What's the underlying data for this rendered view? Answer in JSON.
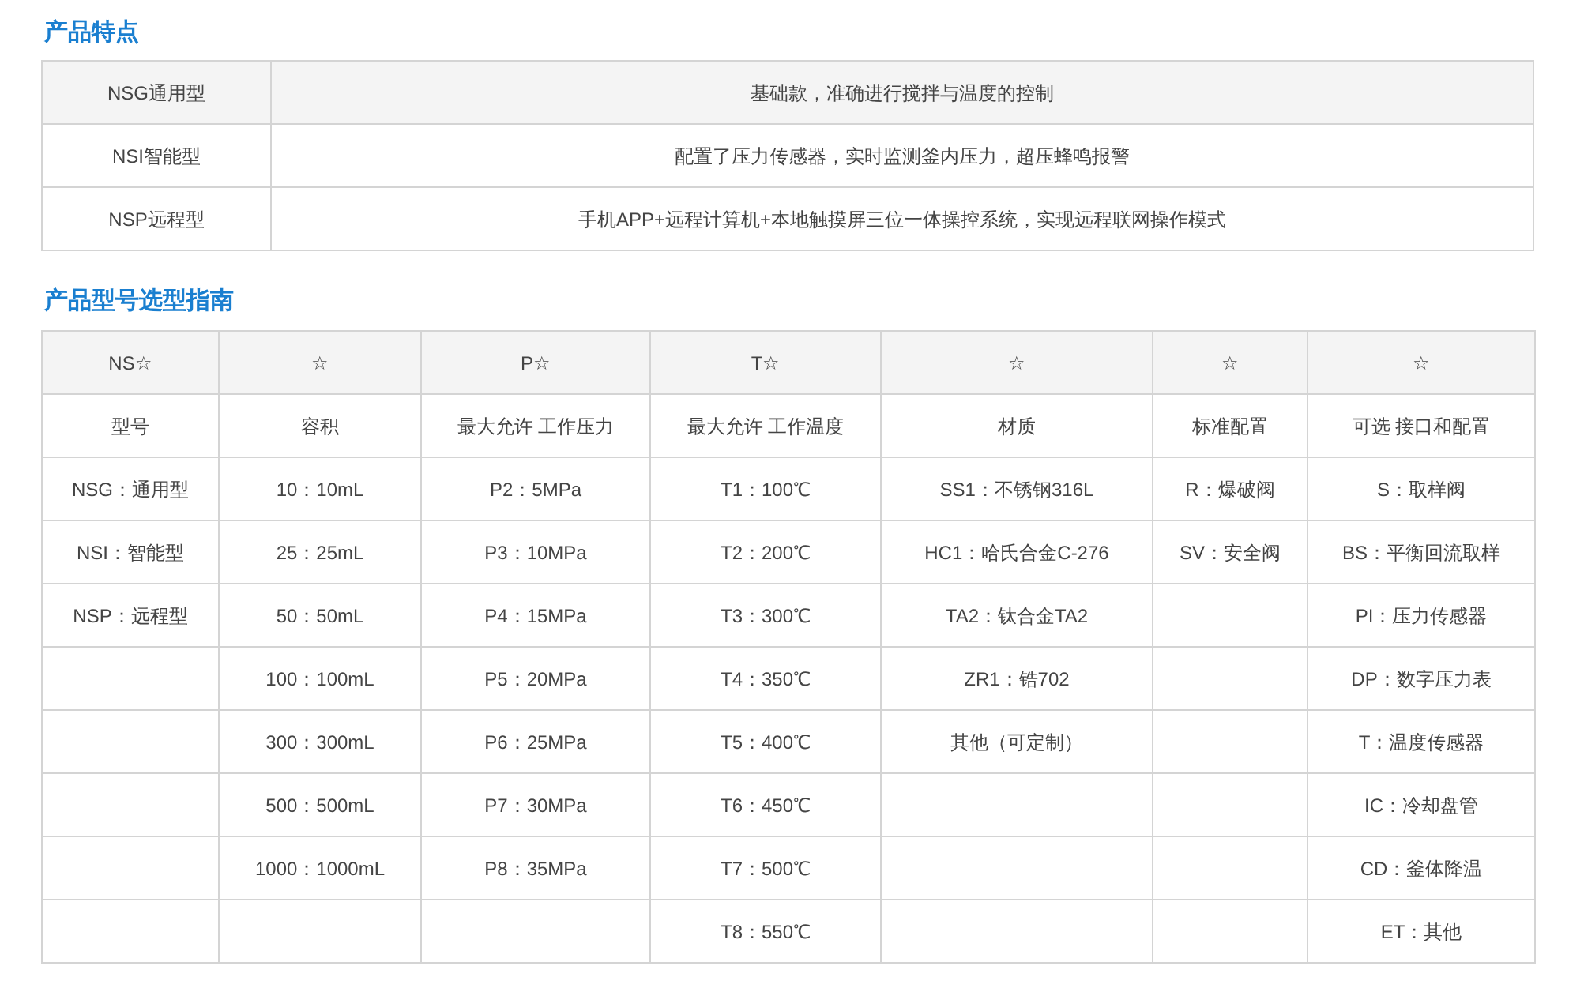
{
  "features": {
    "title": "产品特点",
    "rows": [
      {
        "model": "NSG通用型",
        "description": "基础款，准确进行搅拌与温度的控制"
      },
      {
        "model": "NSI智能型",
        "description": "配置了压力传感器，实时监测釜内压力，超压蜂鸣报警"
      },
      {
        "model": "NSP远程型",
        "description": "手机APP+远程计算机+本地触摸屏三位一体操控系统，实现远程联网操作模式"
      }
    ]
  },
  "guide": {
    "title": "产品型号选型指南",
    "columns": [
      {
        "header": "NS☆",
        "label": "型号",
        "values": [
          "NSG：通用型",
          "NSI：智能型",
          "NSP：远程型"
        ]
      },
      {
        "header": "☆",
        "label": "容积",
        "values": [
          "10：10mL",
          "25：25mL",
          "50：50mL",
          "100：100mL",
          "300：300mL",
          "500：500mL",
          "1000：1000mL"
        ]
      },
      {
        "header": "P☆",
        "label": "最大允许 工作压力",
        "values": [
          "P2：5MPa",
          "P3：10MPa",
          "P4：15MPa",
          "P5：20MPa",
          "P6：25MPa",
          "P7：30MPa",
          "P8：35MPa"
        ]
      },
      {
        "header": "T☆",
        "label": "最大允许 工作温度",
        "values": [
          "T1：100℃",
          "T2：200℃",
          "T3：300℃",
          "T4：350℃",
          "T5：400℃",
          "T6：450℃",
          "T7：500℃",
          "T8：550℃"
        ]
      },
      {
        "header": "☆",
        "label": "材质",
        "values": [
          "SS1：不锈钢316L",
          "HC1：哈氏合金C-276",
          "TA2：钛合金TA2",
          "ZR1：锆702",
          "其他（可定制）"
        ]
      },
      {
        "header": "☆",
        "label": "标准配置",
        "values": [
          "R：爆破阀",
          "SV：安全阀"
        ]
      },
      {
        "header": "☆",
        "label": "可选 接口和配置",
        "values": [
          "S：取样阀",
          "BS：平衡回流取样",
          "PI：压力传感器",
          "DP：数字压力表",
          "T：温度传感器",
          "IC：冷却盘管",
          "CD：釜体降温",
          "ET：其他"
        ]
      }
    ]
  }
}
